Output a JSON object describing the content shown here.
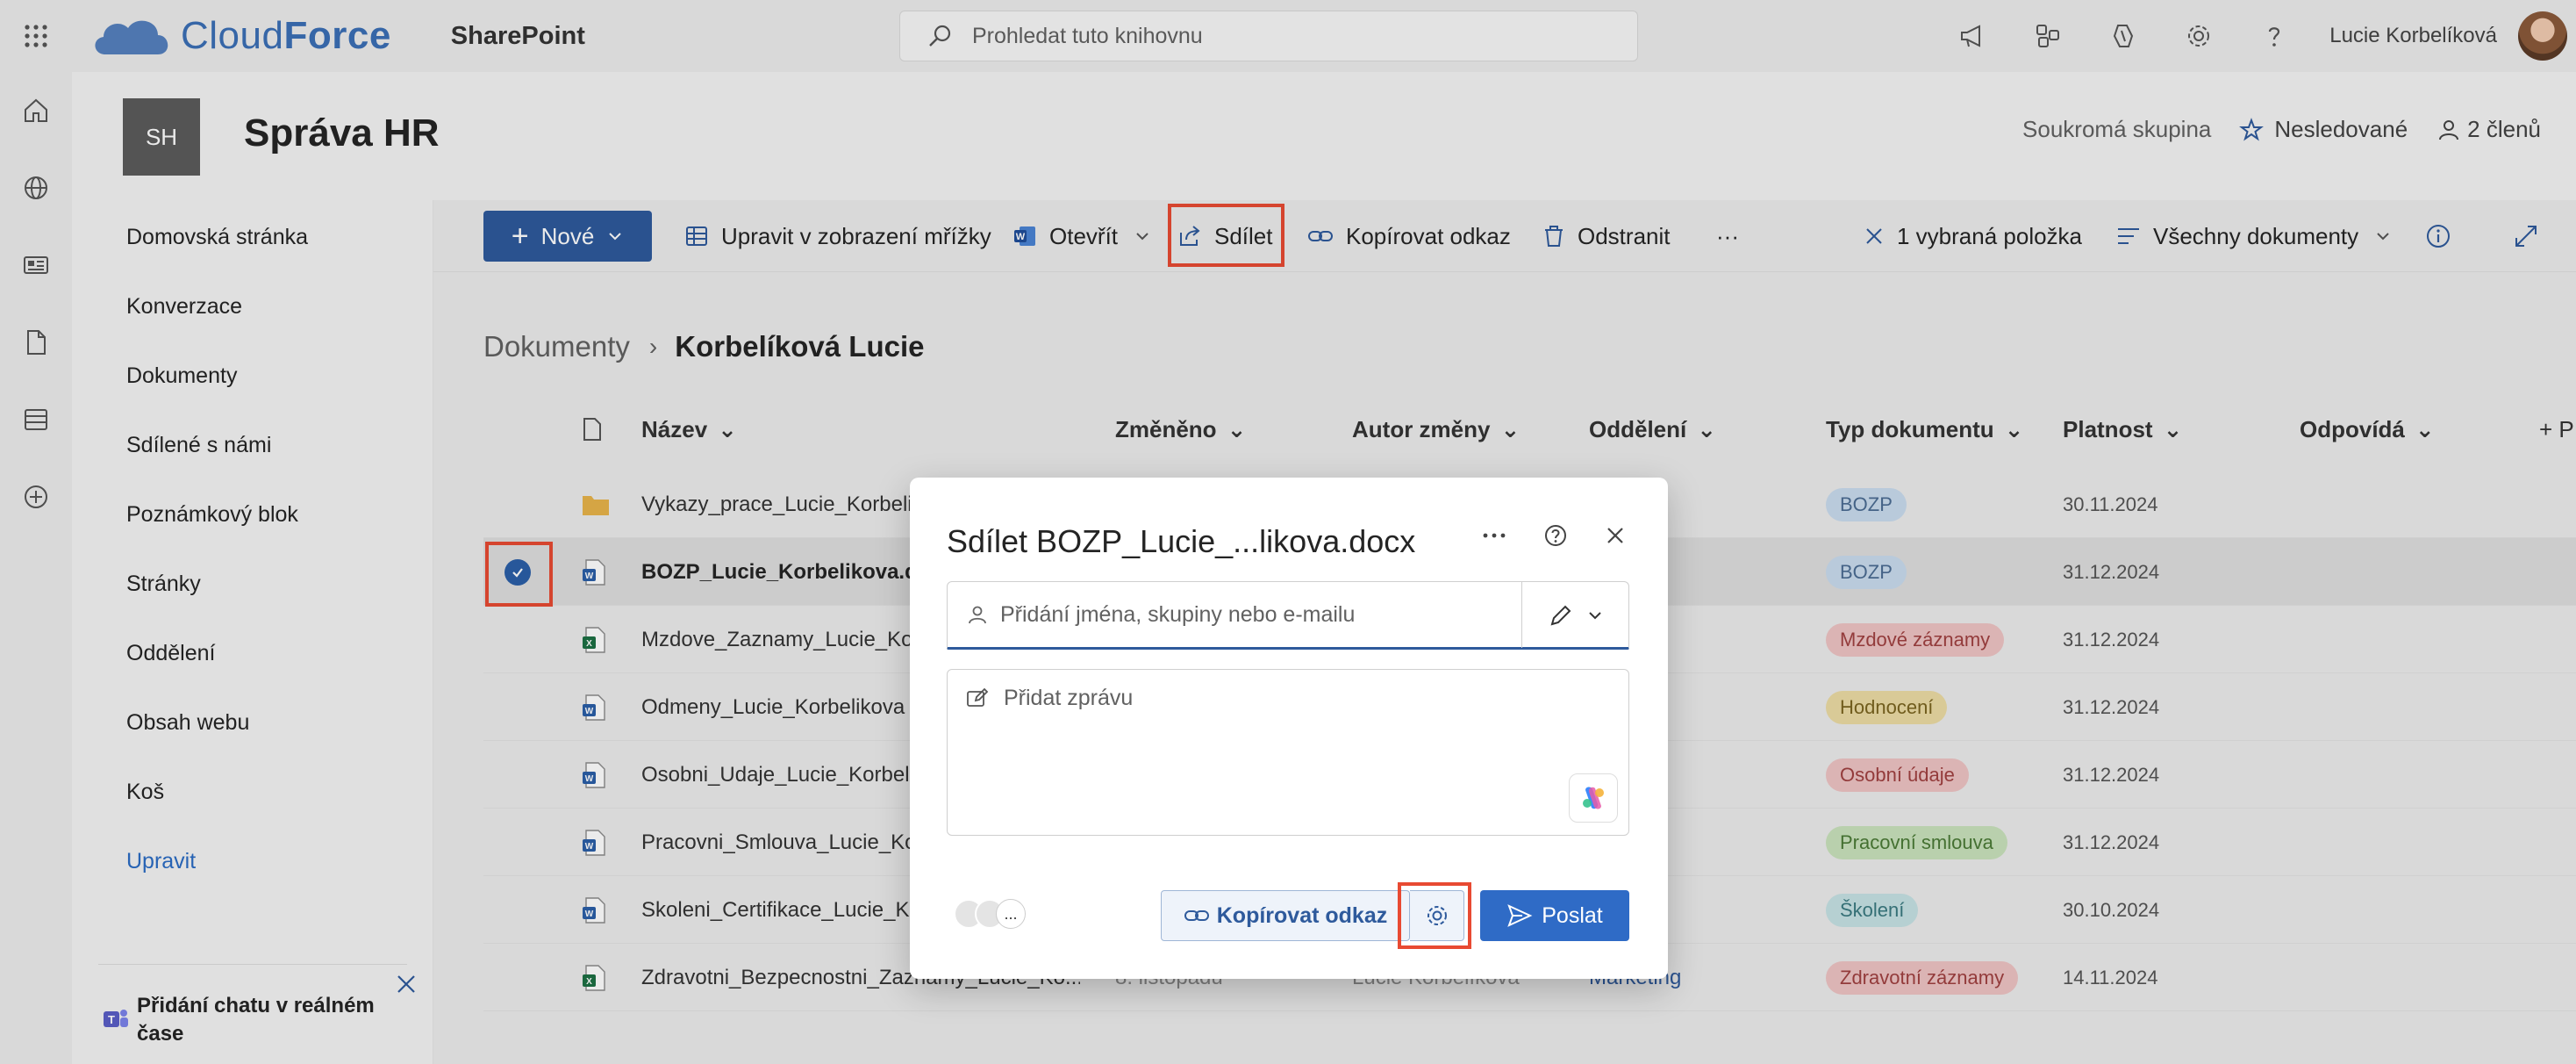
{
  "suite": {
    "brand_prefix": "Cloud",
    "brand_suffix": "Force",
    "app_name": "SharePoint",
    "search_placeholder": "Prohledat tuto knihovnu",
    "user_name": "Lucie Korbelíková"
  },
  "site": {
    "logo_initials": "SH",
    "title": "Správa HR",
    "privacy": "Soukromá skupina",
    "follow_label": "Nesledované",
    "members_label": "2 členů"
  },
  "nav": {
    "items": [
      "Domovská stránka",
      "Konverzace",
      "Dokumenty",
      "Sdílené s námi",
      "Poznámkový blok",
      "Stránky",
      "Oddělení",
      "Obsah webu",
      "Koš"
    ],
    "edit_label": "Upravit",
    "chat_promo": "Přidání chatu v reálném čase"
  },
  "commands": {
    "new": "Nové",
    "grid_edit": "Upravit v zobrazení mřížky",
    "open": "Otevřít",
    "share": "Sdílet",
    "copy_link": "Kopírovat odkaz",
    "delete": "Odstranit",
    "more": "···",
    "selected": "1 vybraná položka",
    "view": "Všechny dokumenty"
  },
  "breadcrumb": {
    "root": "Dokumenty",
    "current": "Korbelíková Lucie"
  },
  "columns": {
    "name": "Název",
    "modified": "Změněno",
    "modified_by": "Autor změny",
    "department": "Oddělení",
    "doc_type": "Typ dokumentu",
    "validity": "Platnost",
    "owner": "Odpovídá",
    "add": "+ P"
  },
  "rows": [
    {
      "name": "Vykazy_prace_Lucie_Korbeli",
      "icon": "folder",
      "department": "g",
      "type": "BOZP",
      "pill": "blue",
      "validity": "30.11.2024"
    },
    {
      "name": "BOZP_Lucie_Korbelikova.do",
      "icon": "word",
      "department": "g",
      "type": "BOZP",
      "pill": "blue",
      "validity": "31.12.2024"
    },
    {
      "name": "Mzdove_Zaznamy_Lucie_Ko",
      "icon": "excel",
      "department": "g",
      "type": "Mzdové záznamy",
      "pill": "red",
      "validity": "31.12.2024"
    },
    {
      "name": "Odmeny_Lucie_Korbelikova",
      "icon": "word",
      "department": "g",
      "type": "Hodnocení",
      "pill": "yellow",
      "validity": "31.12.2024"
    },
    {
      "name": "Osobni_Udaje_Lucie_Korbel",
      "icon": "word",
      "department": "g",
      "type": "Osobní údaje",
      "pill": "red",
      "validity": "31.12.2024"
    },
    {
      "name": "Pracovni_Smlouva_Lucie_Ko",
      "icon": "word",
      "department": "g",
      "type": "Pracovní smlouva",
      "pill": "green",
      "validity": "31.12.2024"
    },
    {
      "name": "Skoleni_Certifikace_Lucie_Ko",
      "icon": "word",
      "department": "g",
      "type": "Školení",
      "pill": "teal",
      "validity": "30.10.2024"
    },
    {
      "name": "Zdravotni_Bezpecnostni_Zaznamy_Lucie_Ko...",
      "icon": "excel",
      "modified": "8. listopadu",
      "modified_by": "Lucie Korbelíková",
      "department": "Marketing",
      "type": "Zdravotní záznamy",
      "pill": "red",
      "validity": "14.11.2024"
    }
  ],
  "dialog": {
    "title": "Sdílet BOZP_Lucie_...likova.docx",
    "people_placeholder": "Přidání jména, skupiny nebo e-mailu",
    "message_placeholder": "Přidat zprávu",
    "more_glyph": "...",
    "copy_link": "Kopírovat odkaz",
    "send": "Poslat"
  },
  "colors": {
    "accent": "#2e5a9c",
    "highlight": "#e84a32"
  }
}
